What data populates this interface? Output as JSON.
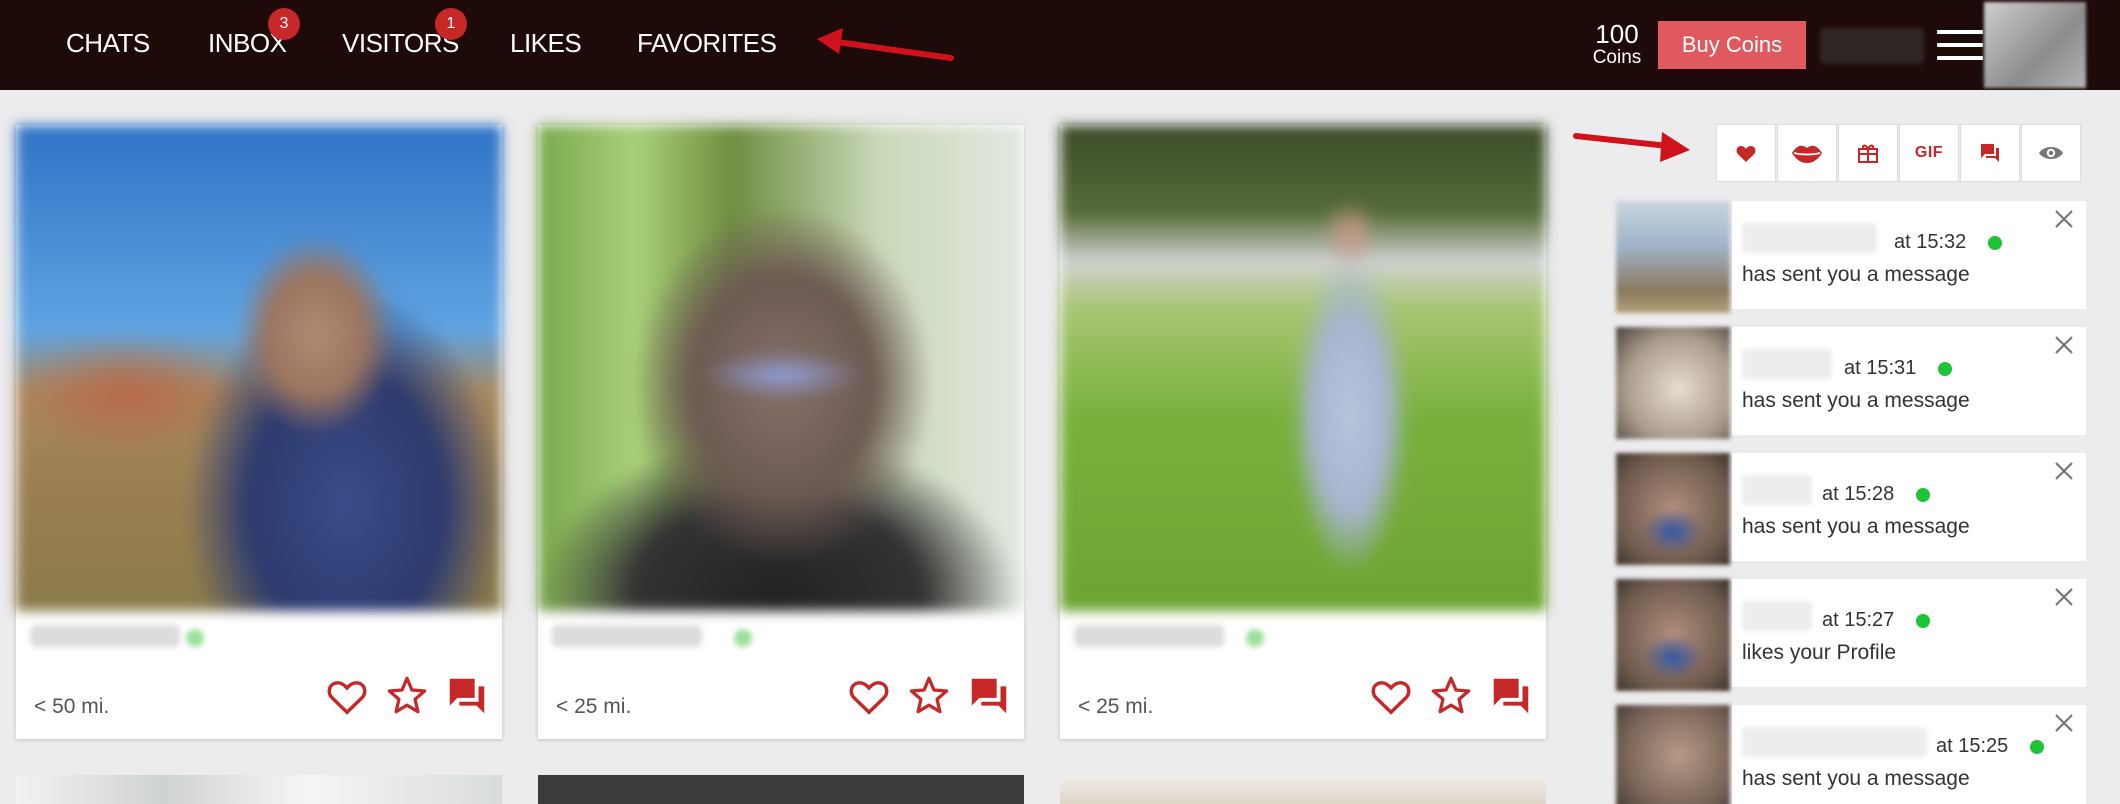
{
  "nav": {
    "items": [
      {
        "label": "CHATS",
        "badge": null
      },
      {
        "label": "INBOX",
        "badge": "3"
      },
      {
        "label": "VISITORS",
        "badge": "1"
      },
      {
        "label": "LIKES",
        "badge": null
      },
      {
        "label": "FAVORITES",
        "badge": null
      }
    ],
    "coins_value": "100",
    "coins_label": "Coins",
    "buy_label": "Buy Coins"
  },
  "colors": {
    "topbar": "#1e0a09",
    "accent_red": "#c62828",
    "buy_button": "#e0595f",
    "online_dot": "#1ec436",
    "annotation_arrow": "#d0121b"
  },
  "toolbar": {
    "icons": [
      "heart-icon",
      "kiss-lips-icon",
      "gift-icon",
      "gif-icon",
      "chat-icon",
      "eye-icon"
    ],
    "gif_label": "GIF"
  },
  "cards": [
    {
      "distance": "< 50 mi.",
      "actions": [
        "heart-icon",
        "star-icon",
        "chat-icon"
      ]
    },
    {
      "distance": "< 25 mi.",
      "actions": [
        "heart-icon",
        "star-icon",
        "chat-icon"
      ]
    },
    {
      "distance": "< 25 mi.",
      "actions": [
        "heart-icon",
        "star-icon",
        "chat-icon"
      ]
    }
  ],
  "notifications": [
    {
      "time": "at 15:32",
      "message": "has sent you a message"
    },
    {
      "time": "at 15:31",
      "message": "has sent you a message"
    },
    {
      "time": "at 15:28",
      "message": "has sent you a message"
    },
    {
      "time": "at 15:27",
      "message": "likes your Profile"
    },
    {
      "time": "at 15:25",
      "message": "has sent you a message"
    }
  ]
}
